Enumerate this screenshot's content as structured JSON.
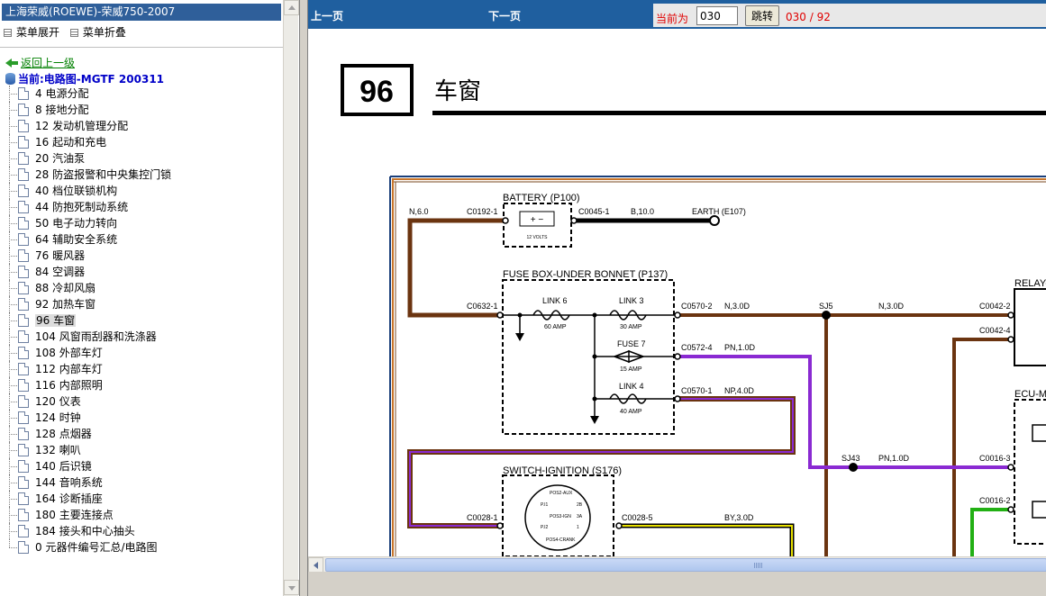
{
  "left_pane": {
    "title": "上海荣威(ROEWE)-荣威750-2007",
    "menu_expand": "菜单展开",
    "menu_collapse": "菜单折叠",
    "back_link": "返回上一级",
    "current_label": "当前:电路图-MGTF 200311",
    "items": [
      {
        "label": "4 电源分配"
      },
      {
        "label": "8 接地分配"
      },
      {
        "label": "12 发动机管理分配"
      },
      {
        "label": "16 起动和充电"
      },
      {
        "label": "20 汽油泵"
      },
      {
        "label": "28 防盗报警和中央集控门锁"
      },
      {
        "label": "40 档位联锁机构"
      },
      {
        "label": "44 防抱死制动系统"
      },
      {
        "label": "50 电子动力转向"
      },
      {
        "label": "64 辅助安全系统"
      },
      {
        "label": "76 暖风器"
      },
      {
        "label": "84 空调器"
      },
      {
        "label": "88 冷却风扇"
      },
      {
        "label": "92 加热车窗"
      },
      {
        "label": "96 车窗",
        "selected": true
      },
      {
        "label": "104 风窗雨刮器和洗涤器"
      },
      {
        "label": "108 外部车灯"
      },
      {
        "label": "112 内部车灯"
      },
      {
        "label": "116 内部照明"
      },
      {
        "label": "120 仪表"
      },
      {
        "label": "124 时钟"
      },
      {
        "label": "128 点烟器"
      },
      {
        "label": "132 喇叭"
      },
      {
        "label": "140 后识镜"
      },
      {
        "label": "144 音响系统"
      },
      {
        "label": "164 诊断插座"
      },
      {
        "label": "180 主要连接点"
      },
      {
        "label": "184 接头和中心抽头"
      },
      {
        "label": "0 元器件编号汇总/电路图"
      }
    ]
  },
  "toolbar": {
    "prev_label": "上一页",
    "next_label": "下一页",
    "current_prefix": "当前为",
    "page_value": "030",
    "go_label": "跳转",
    "page_count": "030 / 92"
  },
  "diagram": {
    "page_number": "96",
    "page_title": "车窗",
    "battery_label": "BATTERY (P100)",
    "battery_rating": "12 VOLTS",
    "fusebox_label": "FUSE BOX-UNDER BONNET (P137)",
    "switch_label": "SWITCH-IGNITION (S176)",
    "relay_label": "RELAY-",
    "ecu_label": "ECU-M",
    "wires": {
      "n60": "N,6.0",
      "c0192": "C0192-1",
      "c0045": "C0045-1",
      "b100": "B,10.0",
      "earth": "EARTH (E107)",
      "c0632": "C0632-1",
      "c0570_2": "C0570-2",
      "n30d_a": "N,3.0D",
      "sj5": "SJ5",
      "n30d_b": "N,3.0D",
      "c0042_2": "C0042-2",
      "c0042_4": "C0042-4",
      "c0572": "C0572-4",
      "pn10d_a": "PN,1.0D",
      "c0570_1": "C0570-1",
      "np40d": "NP,4.0D",
      "sj43": "SJ43",
      "pn10d_b": "PN,1.0D",
      "c0016_3": "C0016-3",
      "c0016_2": "C0016-2",
      "c0028_1": "C0028-1",
      "c0028_5": "C0028-5",
      "by30d": "BY,3.0D"
    },
    "fuses": {
      "link6": "LINK 6",
      "link6_amp": "60 AMP",
      "link3": "LINK 3",
      "link3_amp": "30 AMP",
      "fuse7": "FUSE 7",
      "fuse7_amp": "15 AMP",
      "link4": "LINK 4",
      "link4_amp": "40 AMP"
    },
    "switch_positions": {
      "aux": "POS2-AUX",
      "ign": "POS3-IGN",
      "crank": "POS4-CRANK",
      "p1": "P.I1",
      "p2": "P.I2",
      "p2b": "2B",
      "p3a": "3A",
      "p1b": "1"
    }
  },
  "colors": {
    "toolbar_bg": "#1f5f9f",
    "title_bar_bg": "#2f5f9a",
    "wire_brown": "#6b3410",
    "wire_purple": "#8a2ad2",
    "wire_yellow": "#e8e000",
    "wire_green": "#22b014",
    "page_counter_red": "#e00000"
  }
}
